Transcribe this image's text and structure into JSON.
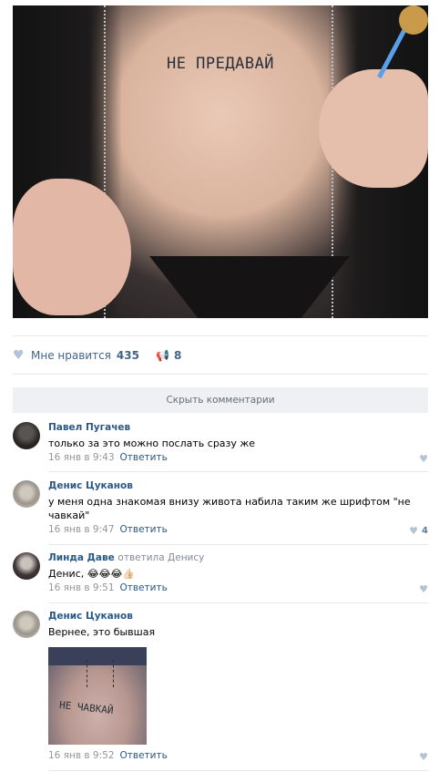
{
  "post": {
    "photo": {
      "tattoo_text": "НЕ ПРЕДАВАЙ"
    },
    "actions": {
      "like_label": "Мне нравится",
      "like_count": "435",
      "share_count": "8"
    },
    "hide_comments_label": "Скрыть комментарии"
  },
  "comments": [
    {
      "author": "Павел Пугачев",
      "text": "только за это можно послать сразу же",
      "date": "16 янв в 9:43",
      "reply_label": "Ответить",
      "likes": ""
    },
    {
      "author": "Денис Цуканов",
      "text": "у меня одна знакомая внизу живота набила таким же шрифтом \"не чавкай\"",
      "date": "16 янв в 9:47",
      "reply_label": "Ответить",
      "likes": "4"
    },
    {
      "author": "Линда Даве",
      "reply_to": "ответила Денису",
      "text": "Денис, 😂😂😂👍🏻",
      "date": "16 янв в 9:51",
      "reply_label": "Ответить",
      "likes": ""
    },
    {
      "author": "Денис Цуканов",
      "text": "Вернее, это бывшая",
      "attachment_text": "НЕ ЧАВКАЙ",
      "date": "16 янв в 9:52",
      "reply_label": "Ответить",
      "likes": ""
    }
  ],
  "icons": {
    "like": "heart-icon",
    "share": "megaphone-icon"
  },
  "colors": {
    "link": "#2a5885",
    "meta": "#939699",
    "action_text": "#42648b",
    "button_bg": "#eef0f3"
  }
}
